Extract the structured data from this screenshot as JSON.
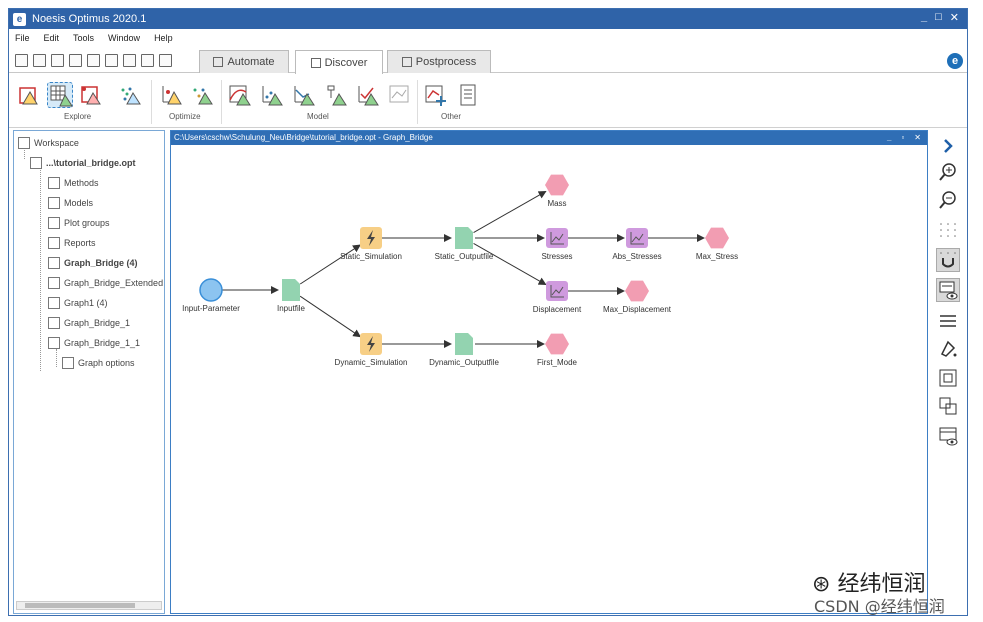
{
  "window": {
    "title": "Noesis Optimus 2020.1",
    "controls": [
      "_",
      "□",
      "✕"
    ]
  },
  "menu": [
    "File",
    "Edit",
    "Tools",
    "Window",
    "Help"
  ],
  "tabs": [
    {
      "label": "Automate",
      "active": false
    },
    {
      "label": "Discover",
      "active": true
    },
    {
      "label": "Postprocess",
      "active": false
    }
  ],
  "ribbon": {
    "groups": [
      {
        "label": "Explore"
      },
      {
        "label": "Optimize"
      },
      {
        "label": "Model"
      },
      {
        "label": "Other"
      }
    ]
  },
  "tree": {
    "root": "Workspace",
    "project": "...\\tutorial_bridge.opt",
    "items": [
      {
        "label": "Methods",
        "bold": false
      },
      {
        "label": "Models",
        "bold": false
      },
      {
        "label": "Plot groups",
        "bold": false
      },
      {
        "label": "Reports",
        "bold": false
      },
      {
        "label": "Graph_Bridge (4)",
        "bold": true
      },
      {
        "label": "Graph_Bridge_Extended",
        "bold": false
      },
      {
        "label": "Graph1 (4)",
        "bold": false
      },
      {
        "label": "Graph_Bridge_1",
        "bold": false
      },
      {
        "label": "Graph_Bridge_1_1",
        "bold": false
      },
      {
        "label": "Graph options",
        "bold": false
      }
    ]
  },
  "graph": {
    "path": "C:\\Users\\cschw\\Schulung_Neu\\Bridge\\tutorial_bridge.opt - Graph_Bridge",
    "nodes": [
      {
        "id": "input",
        "label": "Input-Parameter",
        "kind": "circle"
      },
      {
        "id": "inputfile",
        "label": "Inputfile",
        "kind": "file"
      },
      {
        "id": "static_sim",
        "label": "Static_Simulation",
        "kind": "sim"
      },
      {
        "id": "static_out",
        "label": "Static_Outputfile",
        "kind": "file"
      },
      {
        "id": "mass",
        "label": "Mass",
        "kind": "output"
      },
      {
        "id": "stresses",
        "label": "Stresses",
        "kind": "array"
      },
      {
        "id": "abs_stresses",
        "label": "Abs_Stresses",
        "kind": "array"
      },
      {
        "id": "max_stress",
        "label": "Max_Stress",
        "kind": "output"
      },
      {
        "id": "displacement",
        "label": "Displacement",
        "kind": "array"
      },
      {
        "id": "max_displacement",
        "label": "Max_Displacement",
        "kind": "output"
      },
      {
        "id": "dynamic_sim",
        "label": "Dynamic_Simulation",
        "kind": "sim"
      },
      {
        "id": "dynamic_out",
        "label": "Dynamic_Outputfile",
        "kind": "file"
      },
      {
        "id": "first_mode",
        "label": "First_Mode",
        "kind": "output"
      }
    ],
    "edges": [
      [
        "input",
        "inputfile"
      ],
      [
        "inputfile",
        "static_sim"
      ],
      [
        "inputfile",
        "dynamic_sim"
      ],
      [
        "static_sim",
        "static_out"
      ],
      [
        "static_out",
        "mass"
      ],
      [
        "static_out",
        "stresses"
      ],
      [
        "static_out",
        "displacement"
      ],
      [
        "stresses",
        "abs_stresses"
      ],
      [
        "abs_stresses",
        "max_stress"
      ],
      [
        "displacement",
        "max_displacement"
      ],
      [
        "dynamic_sim",
        "dynamic_out"
      ],
      [
        "dynamic_out",
        "first_mode"
      ]
    ]
  },
  "colors": {
    "titlebar": "#2f63a8",
    "circle": "#8cc4f0",
    "file": "#93d3b0",
    "sim": "#f7cf86",
    "output": "#f29db2",
    "array": "#cf9ade"
  },
  "right_tools": [
    "expand-icon",
    "zoom-in-icon",
    "zoom-out-icon",
    "grid-icon",
    "snap-icon",
    "comment-view-icon",
    "lines-icon",
    "paint-icon",
    "group-icon",
    "ungroup-icon",
    "panel-view-icon"
  ],
  "watermark": {
    "wechat": "经纬恒润",
    "csdn": "CSDN @经纬恒润"
  }
}
